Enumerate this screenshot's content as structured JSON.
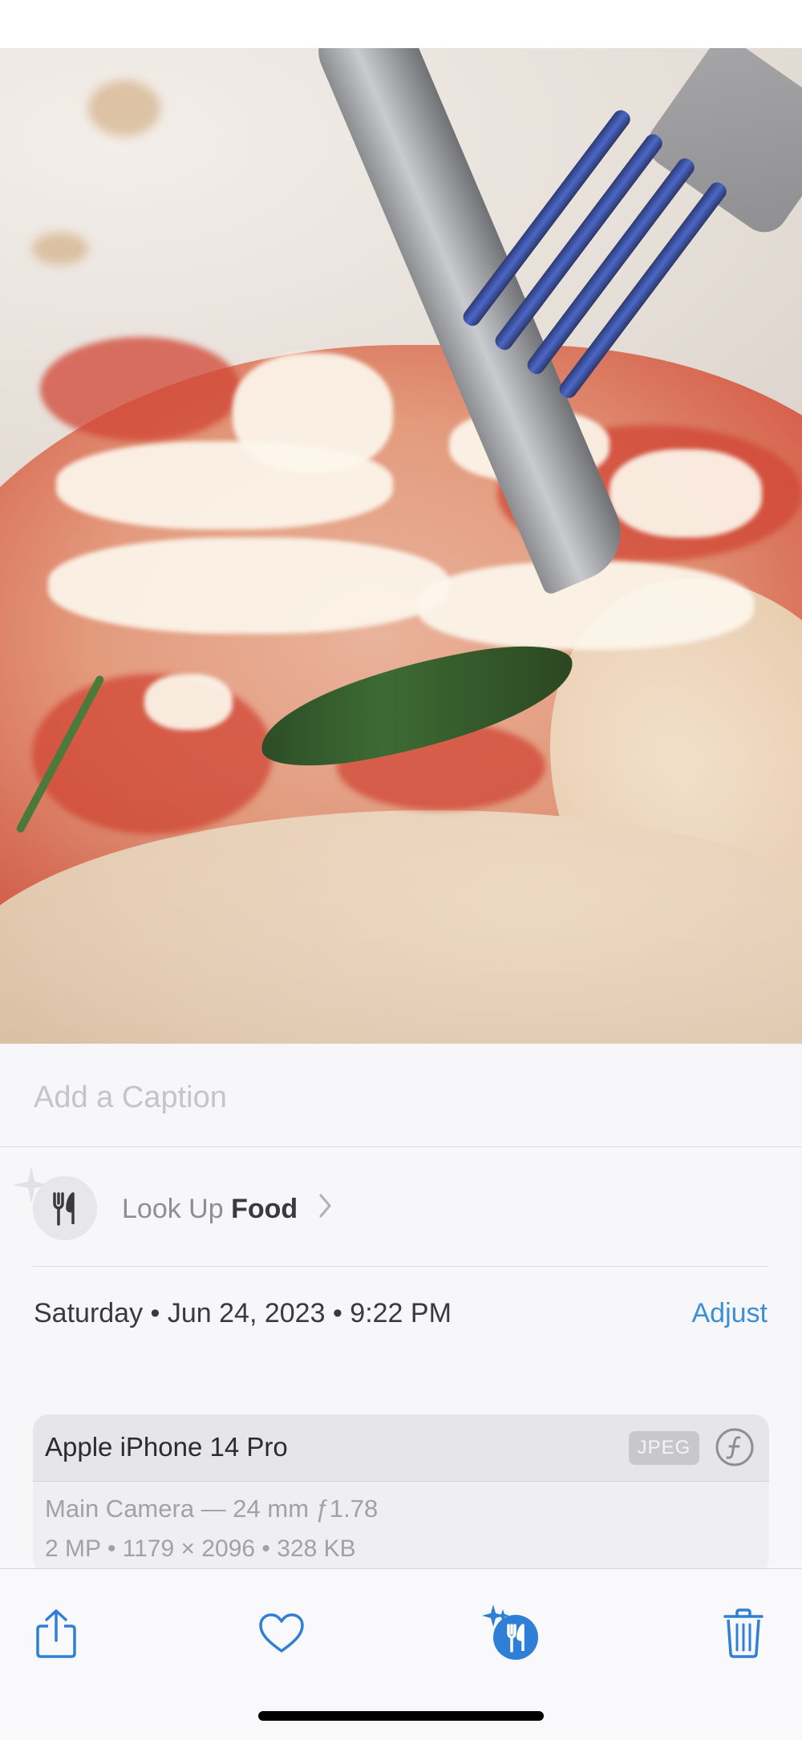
{
  "photo": {
    "description_icon": "pizza-photo"
  },
  "caption": {
    "placeholder": "Add a Caption"
  },
  "lookup": {
    "prefix": "Look Up",
    "subject": "Food",
    "icon": "fork-knife-icon"
  },
  "metadata": {
    "date_text": "Saturday • Jun 24, 2023 • 9:22 PM",
    "adjust_label": "Adjust"
  },
  "device": {
    "name": "Apple iPhone 14 Pro",
    "format_badge": "JPEG",
    "camera_line": "Main Camera — 24 mm ƒ1.78",
    "specs_line": "2 MP  •  1179 × 2096  •  328 KB"
  },
  "toolbar": {
    "items": [
      "share-icon",
      "heart-icon",
      "visual-lookup-food-icon",
      "trash-icon"
    ]
  },
  "colors": {
    "accent": "#3b8fd9",
    "toolbar_icon": "#2f7fd6",
    "background": "#f7f7fa"
  }
}
